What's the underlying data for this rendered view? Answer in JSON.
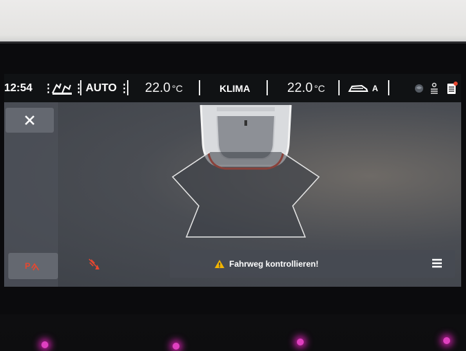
{
  "statusbar": {
    "time": "12:54",
    "auto_label": "AUTO",
    "temp_left": "22.0",
    "temp_left_unit": "°C",
    "klima_label": "KLIMA",
    "temp_right": "22.0",
    "temp_right_unit": "°C",
    "car_mode_label": "A"
  },
  "message_bar": {
    "text": "Fahrweg kontrollieren!"
  },
  "icons": {
    "close": "close-icon",
    "park_assist": "park-assist-icon",
    "sensor": "sensor-off-icon",
    "warning": "warning-icon",
    "menu": "menu-icon",
    "globe": "globe-icon",
    "person": "person-icon",
    "notes": "notes-icon"
  },
  "colors": {
    "accent_red": "#e8472f",
    "warning_yellow": "#f2b400"
  }
}
